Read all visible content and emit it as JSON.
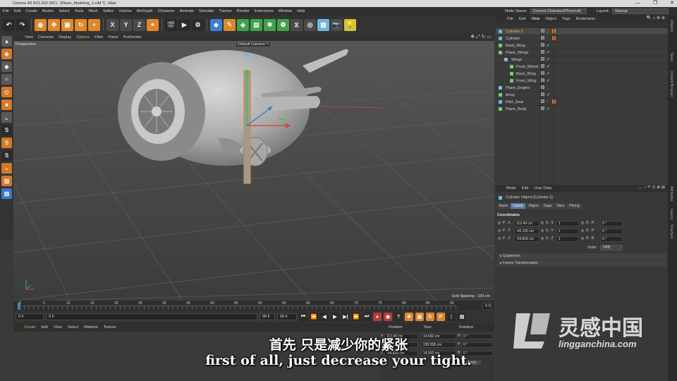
{
  "window": {
    "title": "Cinema 4D R21.022 (RC) - [Plane_Modeling_1.c4d *] - Main",
    "controls": [
      "—",
      "❐",
      "✕"
    ]
  },
  "menubar": {
    "items": [
      "File",
      "Edit",
      "Create",
      "Modes",
      "Select",
      "Tools",
      "Mesh",
      "Spline",
      "Volume",
      "MoGraph",
      "Character",
      "Animate",
      "Simulate",
      "Tracker",
      "Render",
      "Extensions",
      "Window",
      "Help"
    ],
    "node_space_label": "Node Space:",
    "node_space_value": "Current (Standard/Physical)",
    "layout_label": "Layout:",
    "layout_value": "Startup"
  },
  "viewport": {
    "menu": [
      "View",
      "Cameras",
      "Display",
      "Options",
      "Filter",
      "Panel",
      "ProRender"
    ],
    "active_menu": "Options",
    "name": "Perspective",
    "camera": "Default Camera °•",
    "grid_spacing": "Grid Spacing : 100 cm"
  },
  "timeline": {
    "ticks": [
      "0",
      "5",
      "10",
      "15",
      "20",
      "25",
      "30",
      "35",
      "40",
      "45",
      "50",
      "55",
      "60",
      "65",
      "70",
      "75",
      "80",
      "85",
      "90"
    ],
    "frame_end_label": "0 F",
    "current": "0 F",
    "start": "0 F",
    "end": "90 F",
    "end2": "90 F"
  },
  "material_manager": {
    "menu": [
      "Create",
      "Edit",
      "View",
      "Select",
      "Material",
      "Texture"
    ]
  },
  "coordinates": {
    "headers": [
      "Position",
      "Size",
      "Rotation"
    ],
    "rows": [
      {
        "axis": "X",
        "pos": "112.49 cm",
        "size": "14.592 cm",
        "rot_label": "H",
        "rot": "0 °"
      },
      {
        "axis": "Y",
        "pos": "-45.155 cm",
        "size": "235.558 cm",
        "rot_label": "P",
        "rot": "0 °"
      },
      {
        "axis": "Z",
        "pos": "-94.818 cm",
        "size": "14.592 cm",
        "rot_label": "B",
        "rot": "0 °"
      }
    ],
    "apply": "Apply"
  },
  "object_manager": {
    "menu": [
      "File",
      "Edit",
      "View",
      "Object",
      "Tags",
      "Bookmarks"
    ],
    "objects": [
      {
        "name": "Cylinder.1",
        "indent": 0,
        "selected": true,
        "tag": true
      },
      {
        "name": "Cylinder",
        "indent": 0,
        "selected": false,
        "tag": true
      },
      {
        "name": "Back_Wing",
        "indent": 0,
        "selected": false,
        "tag": false
      },
      {
        "name": "Plane_Wings",
        "indent": 0,
        "selected": false,
        "tag": false
      },
      {
        "name": "Wings",
        "indent": 1,
        "selected": false,
        "tag": false
      },
      {
        "name": "Front_Wheel",
        "indent": 2,
        "selected": false,
        "tag": false
      },
      {
        "name": "Back_Wing",
        "indent": 2,
        "selected": false,
        "tag": false
      },
      {
        "name": "Front_Wing",
        "indent": 2,
        "selected": false,
        "tag": false
      },
      {
        "name": "Plane_Engine",
        "indent": 0,
        "selected": false,
        "tag": false
      },
      {
        "name": "Array",
        "indent": 0,
        "selected": false,
        "tag": false
      },
      {
        "name": "Pilot_Seat",
        "indent": 0,
        "selected": false,
        "tag": true
      },
      {
        "name": "Plane_Body",
        "indent": 0,
        "selected": false,
        "tag": false
      }
    ]
  },
  "attributes": {
    "menu": [
      "Mode",
      "Edit",
      "User Data"
    ],
    "object_title": "Cylinder Object [Cylinder.1]",
    "tabs": [
      "Basic",
      "Coord.",
      "Object",
      "Caps",
      "Slice",
      "Phong"
    ],
    "active_tab": "Coord.",
    "section": "Coordinates",
    "rows": [
      {
        "p_label": "P . X",
        "p": "112.49 cm",
        "s_label": "S . X",
        "s": "1",
        "r_label": "R . H",
        "r": "0 °"
      },
      {
        "p_label": "P . Y",
        "p": "-45.155 cm",
        "s_label": "S . Y",
        "s": "1",
        "r_label": "R . P",
        "r": "0 °"
      },
      {
        "p_label": "P . Z",
        "p": "-94.818 cm",
        "s_label": "S . Z",
        "s": "1",
        "r_label": "R . B",
        "r": "0 °"
      }
    ],
    "order_label": "Order",
    "order_value": "HPB",
    "collapsed": [
      "Quaternion",
      "Freeze Transformation"
    ]
  },
  "side_tabs": [
    "Objects",
    "Takes",
    "Content Browser",
    "Attributes",
    "Layers",
    "Structure"
  ],
  "subtitles": {
    "zh": "首先 只是减少你的紧张",
    "en": "first of all, just decrease your tight."
  },
  "watermark": {
    "brand": "灵感中国",
    "url": "lingganchina.com"
  },
  "colors": {
    "accent": "#5a7ea8",
    "selection_orange": "#e0872b",
    "check_green": "#5bd35b"
  }
}
